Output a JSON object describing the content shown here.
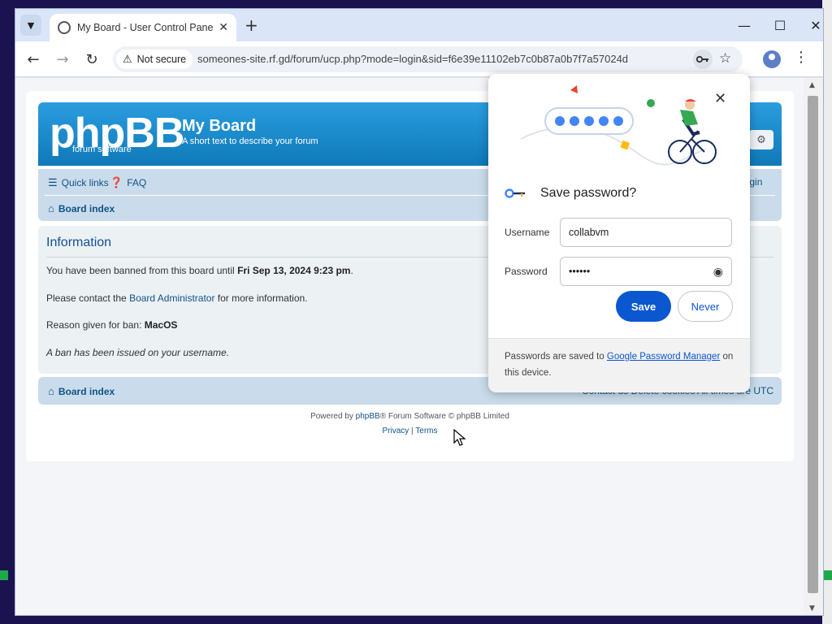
{
  "browser": {
    "tab_title": "My Board - User Control Panel -",
    "new_tab_label": "+",
    "security_chip": "Not secure",
    "url": "someones-site.rf.gd/forum/ucp.php?mode=login&sid=f6e39e11102eb7c0b87a0b7f7a57024d"
  },
  "forum": {
    "logo_text": "phpBB",
    "logo_sub": "forum  software",
    "site_name": "My Board",
    "site_desc": "A short text to describe your forum",
    "nav": {
      "quick_links": "Quick links",
      "faq": "FAQ",
      "login": "Login",
      "board_index": "Board index"
    },
    "info": {
      "heading": "Information",
      "ban_prefix": "You have been banned from this board until ",
      "ban_until": "Fri Sep 13, 2024 9:23 pm",
      "ban_suffix": ".",
      "contact_prefix": "Please contact the ",
      "contact_link": "Board Administrator",
      "contact_suffix": " for more information.",
      "reason_prefix": "Reason given for ban: ",
      "reason": "MacOS",
      "note": "A ban has been issued on your username."
    },
    "footer": {
      "board_index": "Board index",
      "right_text": "Contact us   Delete cookies   All times are UTC",
      "powered_prefix": "Powered by ",
      "powered_link": "phpBB",
      "powered_suffix": "® Forum Software © phpBB Limited",
      "privacy": "Privacy",
      "divider": " | ",
      "terms": "Terms"
    }
  },
  "password_bubble": {
    "title": "Save password?",
    "username_label": "Username",
    "username_value": "collabvm",
    "password_label": "Password",
    "password_value": "••••••",
    "save_label": "Save",
    "never_label": "Never",
    "footer_prefix": "Passwords are saved to ",
    "footer_link": "Google Password Manager",
    "footer_suffix": " on this device."
  },
  "colors": {
    "forum_header": "#1690cf",
    "forum_nav": "#cadceb",
    "link": "#105289",
    "chrome_save": "#0b57d0"
  }
}
